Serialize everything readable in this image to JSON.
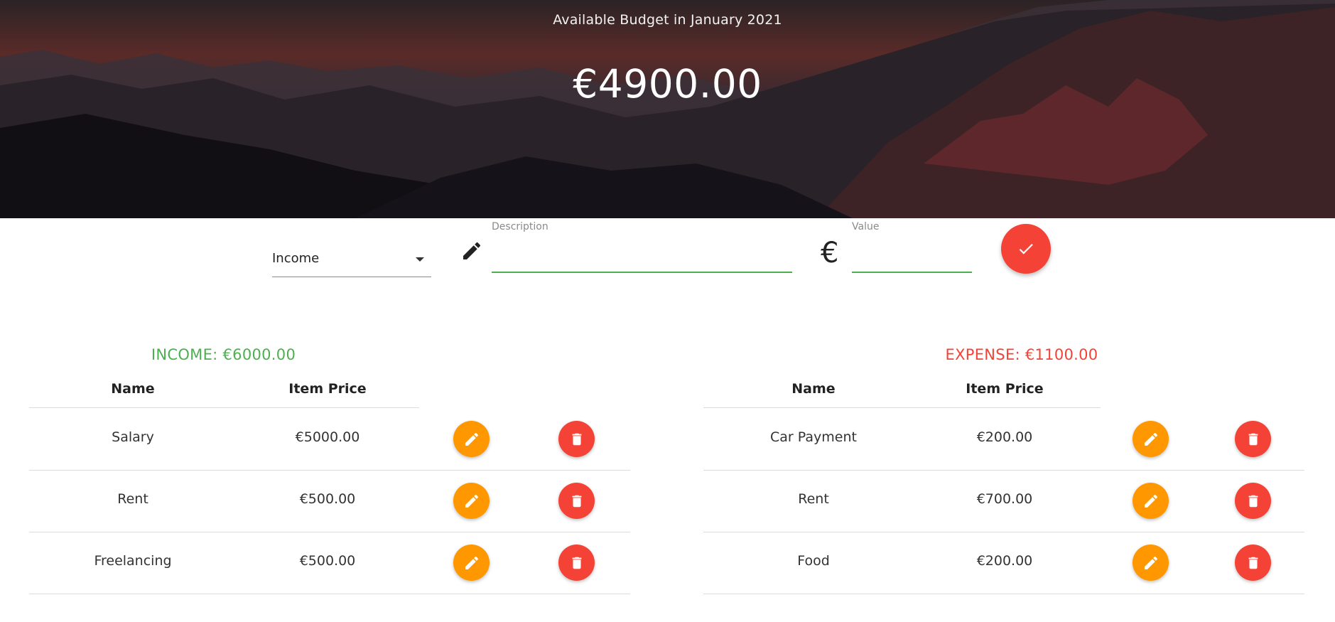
{
  "header": {
    "subtitle": "Available Budget in January 2021",
    "amount": "€4900.00"
  },
  "form": {
    "type_select": {
      "selected": "Income"
    },
    "description": {
      "label": "Description",
      "value": ""
    },
    "currency_symbol": "€",
    "value": {
      "label": "Value",
      "value": ""
    }
  },
  "income": {
    "title": "INCOME: €6000.00",
    "columns": [
      "Name",
      "Item Price"
    ],
    "rows": [
      {
        "name": "Salary",
        "price": "€5000.00"
      },
      {
        "name": "Rent",
        "price": "€500.00"
      },
      {
        "name": "Freelancing",
        "price": "€500.00"
      }
    ]
  },
  "expense": {
    "title": "EXPENSE: €1100.00",
    "columns": [
      "Name",
      "Item Price"
    ],
    "rows": [
      {
        "name": "Car Payment",
        "price": "€200.00"
      },
      {
        "name": "Rent",
        "price": "€700.00"
      },
      {
        "name": "Food",
        "price": "€200.00"
      }
    ]
  },
  "colors": {
    "income": "#4caf50",
    "expense": "#f44336",
    "edit_button": "#ff9800",
    "delete_button": "#f44336",
    "input_underline": "#4caf50"
  },
  "icons": {
    "edit": "pencil-icon",
    "delete": "trash-icon",
    "submit": "check-icon",
    "dropdown": "caret-down-icon"
  }
}
